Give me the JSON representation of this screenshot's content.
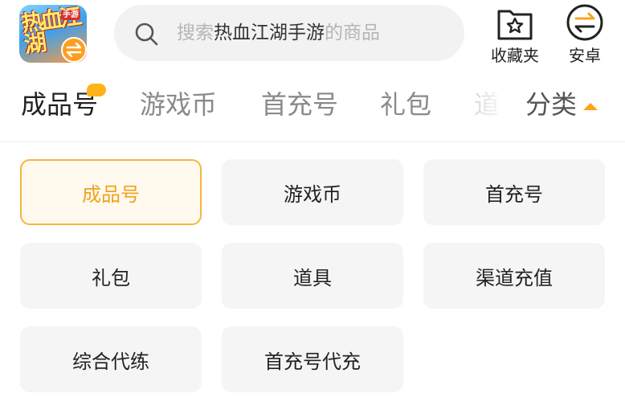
{
  "header": {
    "app_icon": {
      "name": "app-icon",
      "art_text": "热血江湖",
      "badge": "手游"
    },
    "search": {
      "placeholder_prefix": "搜索",
      "placeholder_highlight": "热血江湖手游",
      "placeholder_suffix": "的商品"
    },
    "favorites_label": "收藏夹",
    "android_label": "安卓"
  },
  "tabs": [
    {
      "label": "成品号",
      "active": true
    },
    {
      "label": "游戏币",
      "active": false
    },
    {
      "label": "首充号",
      "active": false
    },
    {
      "label": "礼包",
      "active": false
    },
    {
      "label": "道",
      "active": false
    }
  ],
  "category_toggle": {
    "label": "分类"
  },
  "categories": [
    {
      "label": "成品号",
      "selected": true
    },
    {
      "label": "游戏币",
      "selected": false
    },
    {
      "label": "首充号",
      "selected": false
    },
    {
      "label": "礼包",
      "selected": false
    },
    {
      "label": "道具",
      "selected": false
    },
    {
      "label": "渠道充值",
      "selected": false
    },
    {
      "label": "综合代练",
      "selected": false
    },
    {
      "label": "首充号代充",
      "selected": false
    }
  ],
  "colors": {
    "accent": "#f0a21c",
    "selected_border": "#f5b63d",
    "selected_bg": "#fff9ee",
    "cell_bg": "#f5f5f5",
    "search_bg": "#f2f2f2"
  }
}
